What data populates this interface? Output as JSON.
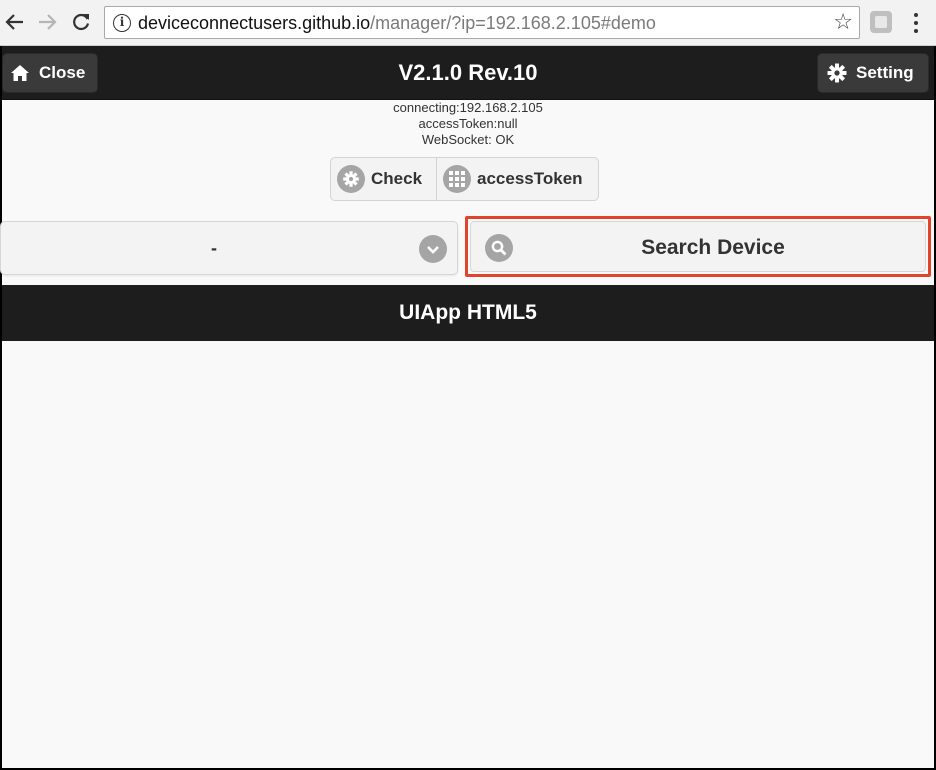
{
  "browser": {
    "url_host": "deviceconnectusers.github.io",
    "url_rest": "/manager/?ip=192.168.2.105#demo"
  },
  "header": {
    "title": "V2.1.0 Rev.10",
    "close_label": "Close",
    "setting_label": "Setting"
  },
  "status": {
    "connecting": "connecting:192.168.2.105",
    "access_token": "accessToken:null",
    "websocket": "WebSocket: OK"
  },
  "controls": {
    "check_label": "Check",
    "access_token_label": "accessToken"
  },
  "device_select": {
    "selected": "-"
  },
  "search": {
    "label": "Search Device"
  },
  "section": {
    "title": "UIApp HTML5"
  },
  "colors": {
    "header_bg": "#1d1d1d",
    "highlight": "#e0442d",
    "icon_disc": "#a5a5a5"
  }
}
